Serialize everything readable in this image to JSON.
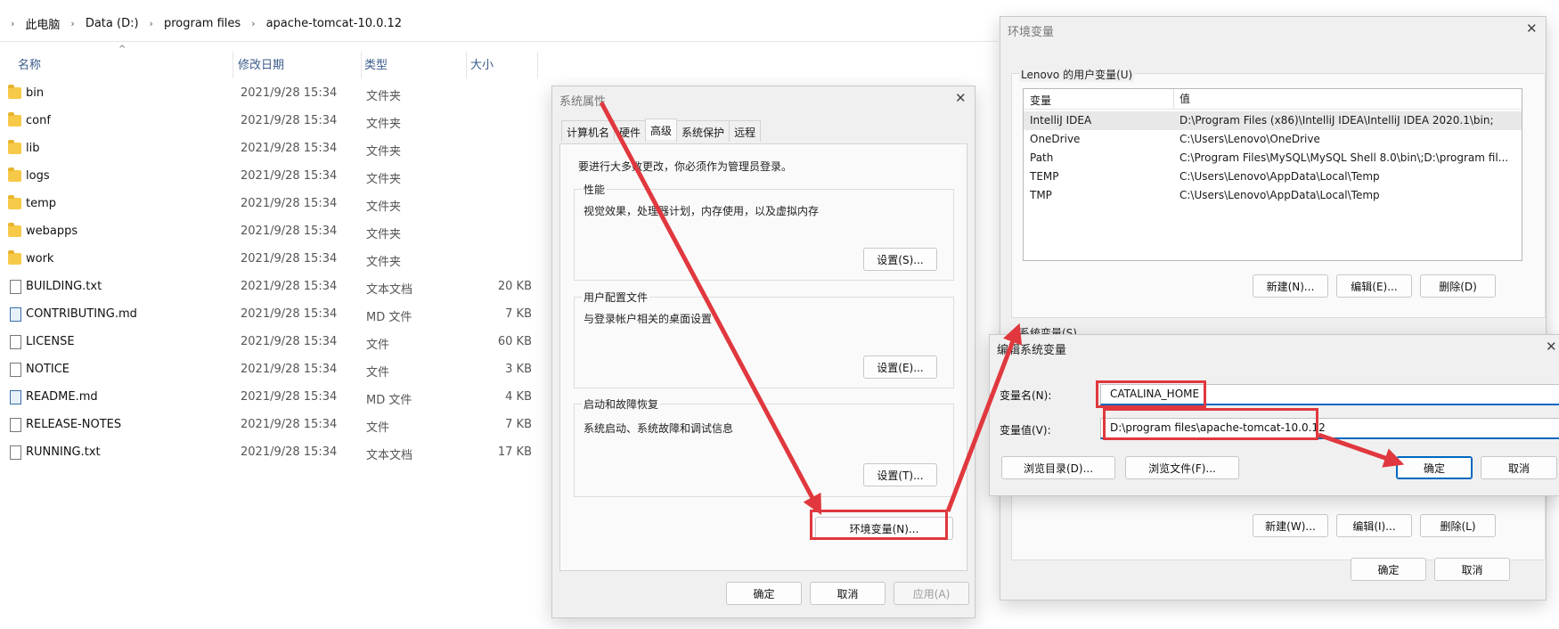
{
  "explorer": {
    "breadcrumb": [
      "此电脑",
      "Data (D:)",
      "program files",
      "apache-tomcat-10.0.12"
    ],
    "columns": {
      "name": "名称",
      "date": "修改日期",
      "type": "类型",
      "size": "大小"
    },
    "files": [
      {
        "name": "bin",
        "date": "2021/9/28 15:34",
        "type": "文件夹",
        "size": "",
        "icon": "folder-icon"
      },
      {
        "name": "conf",
        "date": "2021/9/28 15:34",
        "type": "文件夹",
        "size": "",
        "icon": "folder-icon"
      },
      {
        "name": "lib",
        "date": "2021/9/28 15:34",
        "type": "文件夹",
        "size": "",
        "icon": "folder-icon"
      },
      {
        "name": "logs",
        "date": "2021/9/28 15:34",
        "type": "文件夹",
        "size": "",
        "icon": "folder-icon"
      },
      {
        "name": "temp",
        "date": "2021/9/28 15:34",
        "type": "文件夹",
        "size": "",
        "icon": "folder-icon"
      },
      {
        "name": "webapps",
        "date": "2021/9/28 15:34",
        "type": "文件夹",
        "size": "",
        "icon": "folder-icon"
      },
      {
        "name": "work",
        "date": "2021/9/28 15:34",
        "type": "文件夹",
        "size": "",
        "icon": "folder-icon"
      },
      {
        "name": "BUILDING.txt",
        "date": "2021/9/28 15:34",
        "type": "文本文档",
        "size": "20 KB",
        "icon": "text-file-icon"
      },
      {
        "name": "CONTRIBUTING.md",
        "date": "2021/9/28 15:34",
        "type": "MD 文件",
        "size": "7 KB",
        "icon": "md-file-icon"
      },
      {
        "name": "LICENSE",
        "date": "2021/9/28 15:34",
        "type": "文件",
        "size": "60 KB",
        "icon": "file-icon"
      },
      {
        "name": "NOTICE",
        "date": "2021/9/28 15:34",
        "type": "文件",
        "size": "3 KB",
        "icon": "file-icon"
      },
      {
        "name": "README.md",
        "date": "2021/9/28 15:34",
        "type": "MD 文件",
        "size": "4 KB",
        "icon": "md-file-icon"
      },
      {
        "name": "RELEASE-NOTES",
        "date": "2021/9/28 15:34",
        "type": "文件",
        "size": "7 KB",
        "icon": "file-icon"
      },
      {
        "name": "RUNNING.txt",
        "date": "2021/9/28 15:34",
        "type": "文本文档",
        "size": "17 KB",
        "icon": "text-file-icon"
      }
    ]
  },
  "sysprops": {
    "title": "系统属性",
    "tabs": [
      "计算机名",
      "硬件",
      "高级",
      "系统保护",
      "远程"
    ],
    "admin_note": "要进行大多数更改，你必须作为管理员登录。",
    "performance": {
      "label": "性能",
      "desc": "视觉效果，处理器计划，内存使用，以及虚拟内存",
      "button": "设置(S)..."
    },
    "user_profiles": {
      "label": "用户配置文件",
      "desc": "与登录帐户相关的桌面设置",
      "button": "设置(E)..."
    },
    "startup": {
      "label": "启动和故障恢复",
      "desc": "系统启动、系统故障和调试信息",
      "button": "设置(T)..."
    },
    "env_button": "环境变量(N)...",
    "ok": "确定",
    "cancel": "取消",
    "apply": "应用(A)"
  },
  "envvars": {
    "title": "环境变量",
    "user_label": "Lenovo 的用户变量(U)",
    "header_var": "变量",
    "header_val": "值",
    "user_rows": [
      {
        "name": "IntelliJ IDEA",
        "value": "D:\\Program Files (x86)\\IntelliJ IDEA\\IntelliJ IDEA 2020.1\\bin;"
      },
      {
        "name": "OneDrive",
        "value": "C:\\Users\\Lenovo\\OneDrive"
      },
      {
        "name": "Path",
        "value": "C:\\Program Files\\MySQL\\MySQL Shell 8.0\\bin\\;D:\\program fil..."
      },
      {
        "name": "TEMP",
        "value": "C:\\Users\\Lenovo\\AppData\\Local\\Temp"
      },
      {
        "name": "TMP",
        "value": "C:\\Users\\Lenovo\\AppData\\Local\\Temp"
      }
    ],
    "user_new": "新建(N)...",
    "user_edit": "编辑(E)...",
    "user_delete": "删除(D)",
    "sys_label": "系统变量(S)",
    "sys_new": "新建(W)...",
    "sys_edit": "编辑(I)...",
    "sys_delete": "删除(L)",
    "ok": "确定",
    "cancel": "取消"
  },
  "editvar": {
    "title": "编辑系统变量",
    "name_label": "变量名(N):",
    "name_value": "CATALINA_HOME",
    "value_label": "变量值(V):",
    "value_value": "D:\\program files\\apache-tomcat-10.0.12",
    "browse_dir": "浏览目录(D)...",
    "browse_file": "浏览文件(F)...",
    "ok": "确定",
    "cancel": "取消"
  },
  "colors": {
    "accent": "#0067c0",
    "annotation": "#e0383e",
    "folder": "#f7c948"
  }
}
